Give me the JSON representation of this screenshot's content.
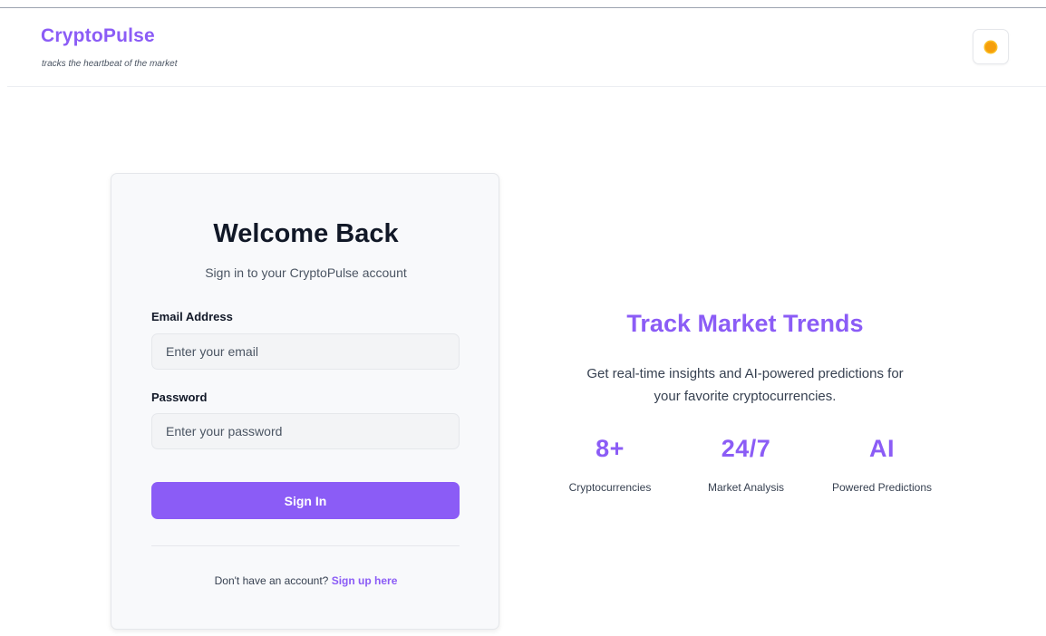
{
  "header": {
    "brand": "CryptoPulse",
    "tagline": "tracks the heartbeat of the market",
    "theme_toggle_icon": "sun-icon"
  },
  "login": {
    "title": "Welcome Back",
    "subtitle": "Sign in to your CryptoPulse account",
    "email_label": "Email Address",
    "email_value": "",
    "email_placeholder": "Enter your email",
    "password_label": "Password",
    "password_value": "",
    "password_placeholder": "Enter your password",
    "submit_label": "Sign In",
    "signup_prompt": "Don't have an account?",
    "signup_link": "Sign up here"
  },
  "promo": {
    "title": "Track Market Trends",
    "text_line1": "Get real-time insights and AI-powered predictions for",
    "text_line2": "your favorite cryptocurrencies.",
    "stats": [
      {
        "value": "8+",
        "label": "Cryptocurrencies"
      },
      {
        "value": "24/7",
        "label": "Market Analysis"
      },
      {
        "value": "AI",
        "label": "Powered Predictions"
      }
    ]
  },
  "colors": {
    "accent": "#8b5cf6",
    "sun": "#f59e0b"
  }
}
